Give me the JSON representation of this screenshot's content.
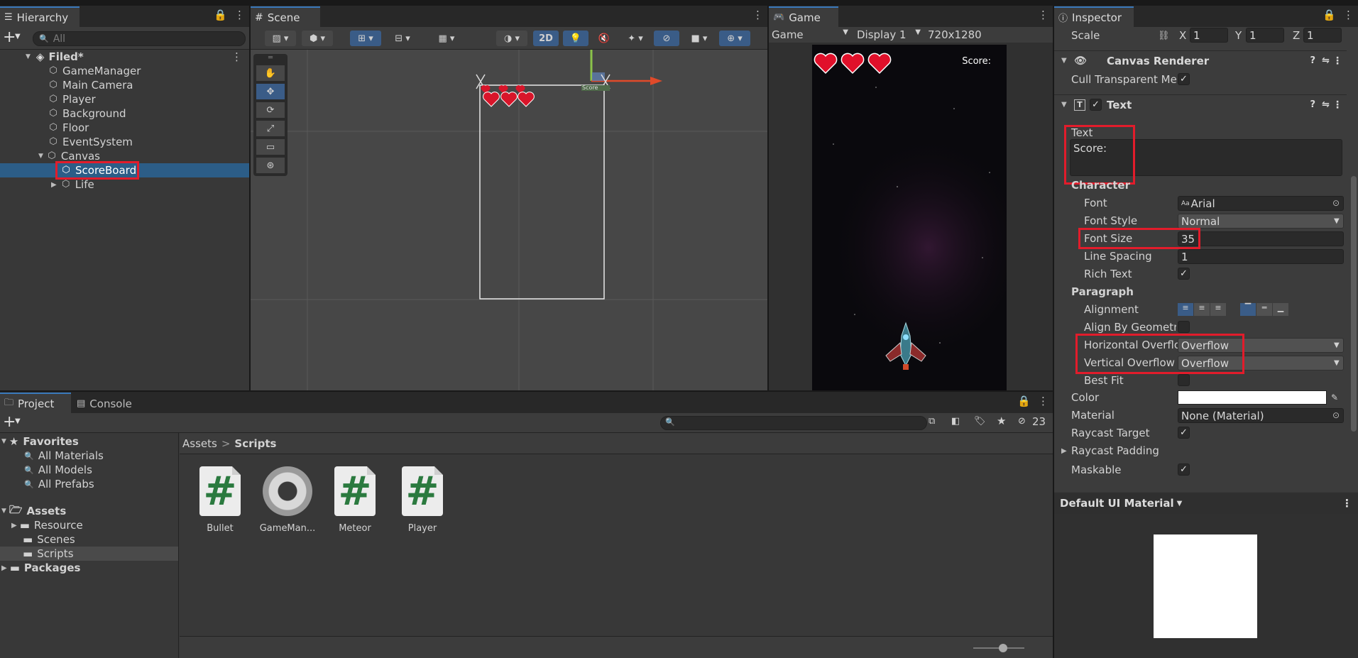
{
  "hierarchy": {
    "tab_label": "Hierarchy",
    "search_placeholder": "All",
    "scene_name": "Filed*",
    "items": [
      {
        "label": "GameManager"
      },
      {
        "label": "Main Camera"
      },
      {
        "label": "Player"
      },
      {
        "label": "Background"
      },
      {
        "label": "Floor"
      },
      {
        "label": "EventSystem"
      },
      {
        "label": "Canvas"
      },
      {
        "label": "ScoreBoard"
      },
      {
        "label": "Life"
      }
    ]
  },
  "scene": {
    "tab_label": "Scene",
    "mode_2d": "2D",
    "score_tiny": "Score"
  },
  "game": {
    "tab_label": "Game",
    "view_select": "Game",
    "display_select": "Display 1",
    "resolution": "720x1280",
    "score_text": "Score:"
  },
  "inspector": {
    "tab_label": "Inspector",
    "scale": {
      "label": "Scale",
      "x_label": "X",
      "x": "1",
      "y_label": "Y",
      "y": "1",
      "z_label": "Z",
      "z": "1"
    },
    "canvas_renderer": {
      "title": "Canvas Renderer",
      "cull_label": "Cull Transparent Me:"
    },
    "text_component": {
      "title": "Text",
      "text_label": "Text",
      "text_value": "Score:",
      "character_header": "Character",
      "font_label": "Font",
      "font_prefix": "Aa",
      "font_value": "Arial",
      "font_style_label": "Font Style",
      "font_style_value": "Normal",
      "font_size_label": "Font Size",
      "font_size_value": "35",
      "line_spacing_label": "Line Spacing",
      "line_spacing_value": "1",
      "rich_text_label": "Rich Text",
      "paragraph_header": "Paragraph",
      "alignment_label": "Alignment",
      "align_geometry_label": "Align By Geometry",
      "horizontal_overflow_label": "Horizontal Overflo",
      "horizontal_overflow_value": "Overflow",
      "vertical_overflow_label": "Vertical Overflow",
      "vertical_overflow_value": "Overflow",
      "best_fit_label": "Best Fit",
      "color_label": "Color",
      "color_value": "#ffffff",
      "material_label": "Material",
      "material_value": "None (Material)",
      "raycast_target_label": "Raycast Target",
      "raycast_padding_label": "Raycast Padding",
      "maskable_label": "Maskable"
    },
    "material_preview_label": "Default UI Material"
  },
  "project": {
    "tab_project": "Project",
    "tab_console": "Console",
    "hidden_count": "23",
    "favorites": {
      "label": "Favorites",
      "items": [
        "All Materials",
        "All Models",
        "All Prefabs"
      ]
    },
    "assets": {
      "label": "Assets",
      "items": [
        "Resource",
        "Scenes",
        "Scripts"
      ]
    },
    "packages": "Packages",
    "breadcrumb_root": "Assets",
    "breadcrumb_sep": ">",
    "breadcrumb_current": "Scripts",
    "files": [
      {
        "name": "Bullet",
        "icon": "script-icon"
      },
      {
        "name": "GameMan...",
        "icon": "gear-icon"
      },
      {
        "name": "Meteor",
        "icon": "script-icon"
      },
      {
        "name": "Player",
        "icon": "script-icon"
      }
    ]
  },
  "colors": {
    "selection": "#2c5d87",
    "highlight_box": "#e21c2b",
    "panel_bg": "#383838"
  }
}
